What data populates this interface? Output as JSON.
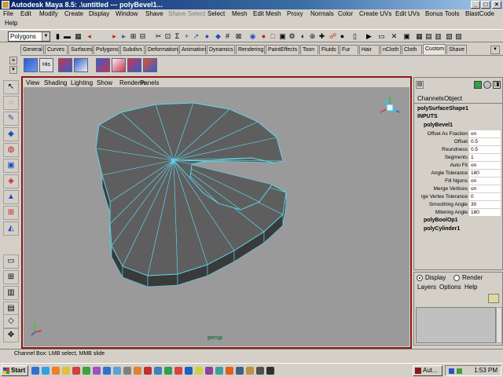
{
  "window": {
    "title": "Autodesk Maya 8.5: .\\untitled   ---   polyBevel1..."
  },
  "menu": {
    "items": [
      "File",
      "Edit",
      "Modify",
      "Create",
      "Display",
      "Window",
      "Shave",
      "Shave Select",
      "Select",
      "Mesh",
      "Edit Mesh",
      "Proxy",
      "Normals",
      "Color",
      "Create UVs",
      "Edit UVs",
      "Bonus Tools",
      "BlastCode",
      "Help"
    ],
    "disabled_item": "Shave Select"
  },
  "status_line": {
    "menu_set": "Polygons"
  },
  "shelf": {
    "tabs": [
      "General",
      "Curves",
      "Surfaces",
      "Polygons",
      "Subdivs",
      "Deformation",
      "Animation",
      "Dynamics",
      "Rendering",
      "PaintEffects",
      "Toon",
      "Fluids",
      "Fur",
      "Hair",
      "nCloth",
      "Cloth",
      "Custom",
      "Shave"
    ],
    "active_tab": "Custom",
    "icon_text": "His"
  },
  "panel": {
    "menu": [
      "View",
      "Shading",
      "Lighting",
      "Show",
      "Renderer",
      "Panels"
    ],
    "camera_label": "persp",
    "border_color": "#8b1a1a",
    "background_color": "#9a9a9a",
    "wire_color": "#5ed8f0"
  },
  "channel_box": {
    "menu": [
      "Channels",
      "Object"
    ],
    "shape_name": "polySurfaceShape1",
    "inputs_label": "INPUTS",
    "node_name": "polyBevel1",
    "attributes": [
      {
        "name": "Offset As Fraction",
        "value": "on"
      },
      {
        "name": "Offset",
        "value": "0.5"
      },
      {
        "name": "Roundness",
        "value": "0.5"
      },
      {
        "name": "Segments",
        "value": "1"
      },
      {
        "name": "Auto Fit",
        "value": "on"
      },
      {
        "name": "Angle Tolerance",
        "value": "180"
      },
      {
        "name": "Fill Ngons",
        "value": "on"
      },
      {
        "name": "Merge Vertices",
        "value": "on"
      },
      {
        "name": "rge Vertex Tolerance",
        "value": "0"
      },
      {
        "name": "Smoothing Angle",
        "value": "30"
      },
      {
        "name": "Mitering Angle",
        "value": "180"
      }
    ],
    "other_nodes": [
      "polyBoolOp1",
      "polyCylinder1"
    ]
  },
  "layer_editor": {
    "display_label": "Display",
    "render_label": "Render",
    "menu": [
      "Layers",
      "Options",
      "Help"
    ]
  },
  "help_line": {
    "text": "Channel Box: LMB select, MMB slide"
  },
  "taskbar": {
    "start_label": "Start",
    "task_label": "Aut...",
    "clock": "1:53 PM"
  }
}
